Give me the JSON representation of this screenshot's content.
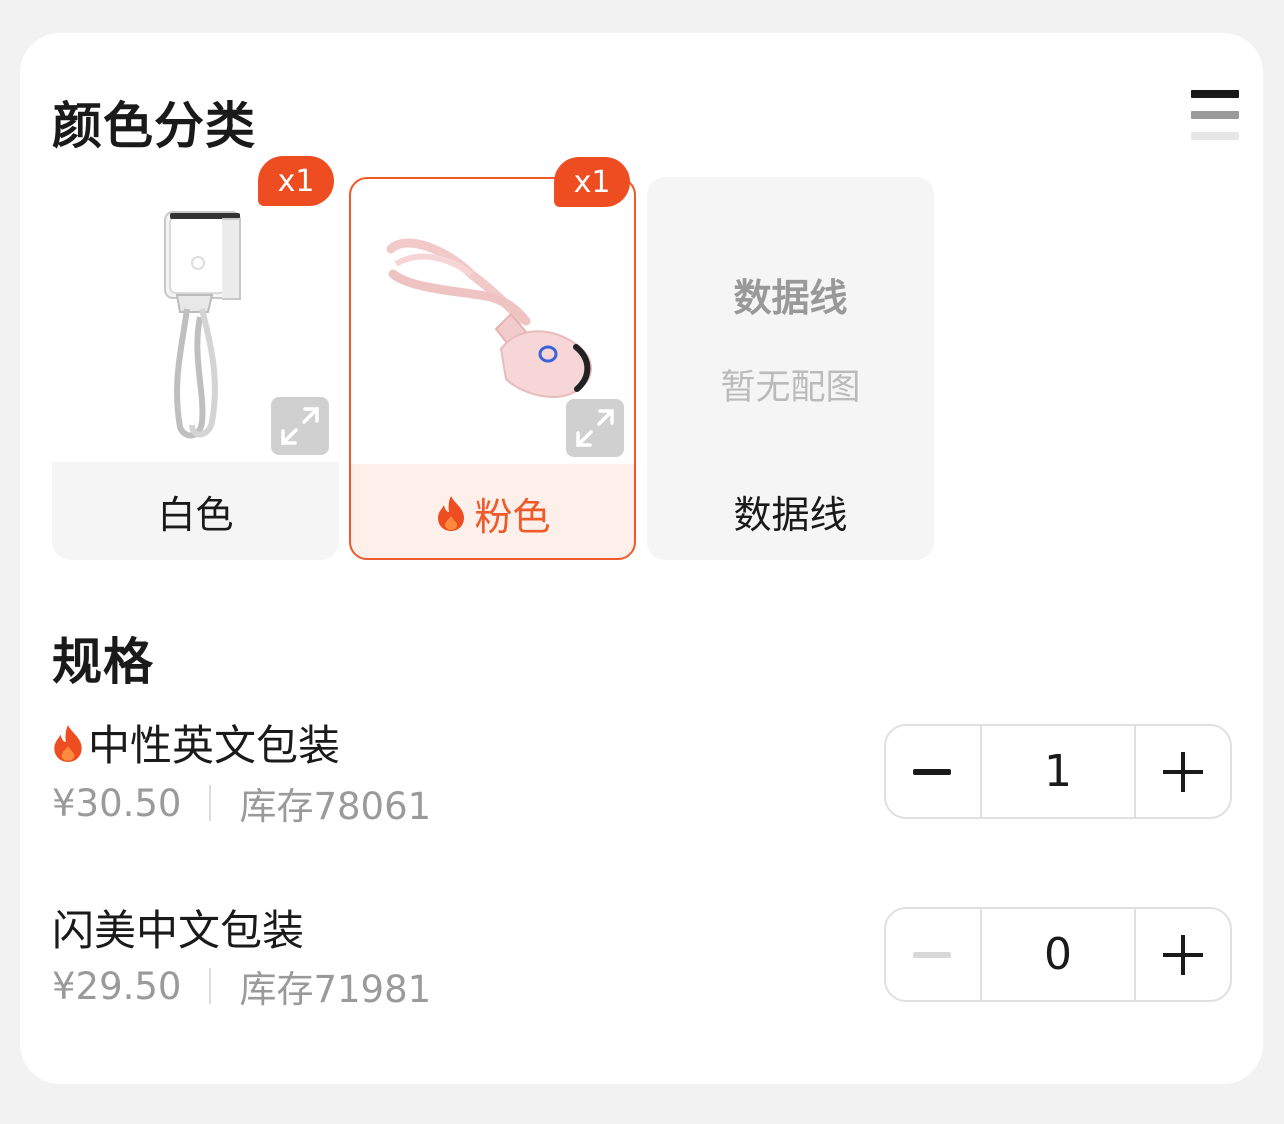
{
  "color_section": {
    "title": "颜色分类",
    "view_toggle_icon": "list-view-icon",
    "options": [
      {
        "label": "白色",
        "badge": "x1",
        "image": "white-eyelash-curler",
        "selected": false,
        "hot": false
      },
      {
        "label": "粉色",
        "badge": "x1",
        "image": "pink-eyelash-curler",
        "selected": true,
        "hot": true
      },
      {
        "label": "数据线",
        "image_title": "数据线",
        "no_image_text": "暂无配图",
        "selected": false,
        "hot": false
      }
    ]
  },
  "spec_section": {
    "title": "规格",
    "items": [
      {
        "name": "中性英文包装",
        "hot": true,
        "price": "¥30.50",
        "stock": "库存78061",
        "quantity": "1",
        "minus_enabled": true
      },
      {
        "name": "闪美中文包装",
        "hot": false,
        "price": "¥29.50",
        "stock": "库存71981",
        "quantity": "0",
        "minus_enabled": false
      }
    ]
  },
  "colors": {
    "accent": "#ee5a2a",
    "badge": "#ee4d22",
    "muted_text": "#9a9a9a"
  }
}
